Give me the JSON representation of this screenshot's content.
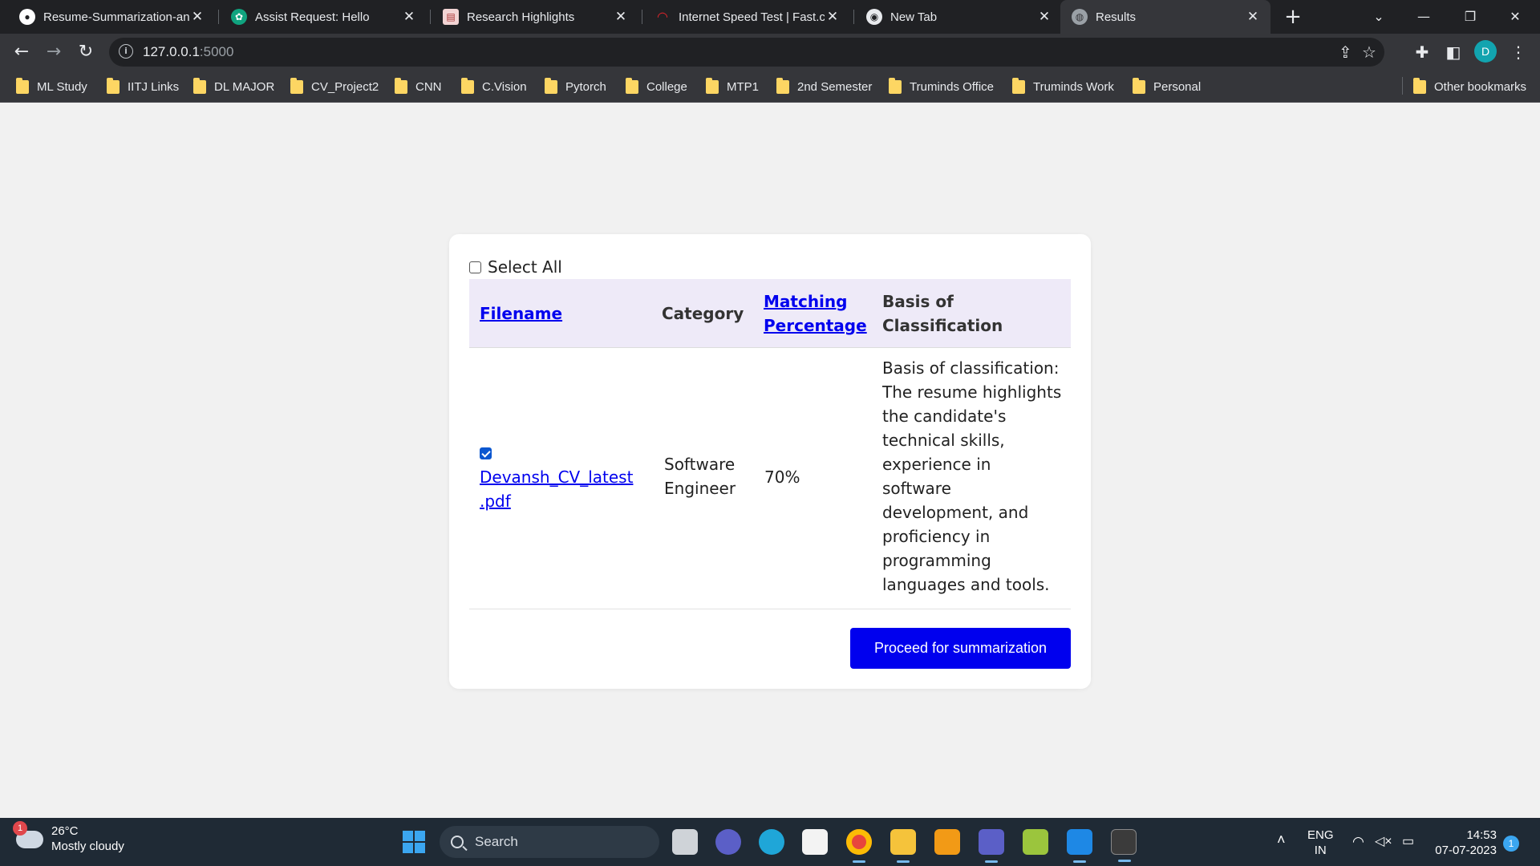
{
  "browser": {
    "tabs": [
      {
        "title": "Resume-Summarization-an",
        "icon": "github-icon"
      },
      {
        "title": "Assist Request: Hello",
        "icon": "chatgpt-icon"
      },
      {
        "title": "Research Highlights",
        "icon": "document-icon"
      },
      {
        "title": "Internet Speed Test | Fast.co",
        "icon": "speedometer-icon"
      },
      {
        "title": "New Tab",
        "icon": "chrome-icon"
      },
      {
        "title": "Results",
        "icon": "globe-icon",
        "active": true
      }
    ],
    "url_host": "127.0.0.1",
    "url_port": ":5000",
    "profile_initial": "D",
    "bookmarks": [
      "ML Study",
      "IITJ Links",
      "DL MAJOR",
      "CV_Project2",
      "CNN",
      "C.Vision",
      "Pytorch",
      "College",
      "MTP1",
      "2nd Semester",
      "Truminds Office",
      "Truminds Work",
      "Personal"
    ],
    "other_bookmarks": "Other bookmarks"
  },
  "page": {
    "select_all_label": "Select All",
    "select_all_checked": false,
    "columns": {
      "filename": "Filename",
      "category": "Category",
      "matching_line1": "Matching",
      "matching_line2": "Percentage",
      "basis": "Basis of Classification"
    },
    "rows": [
      {
        "checked": true,
        "filename_line1": "Devansh_CV_latest",
        "filename_line2": ".pdf",
        "category_line1": "Software",
        "category_line2": "Engineer",
        "matching": "70%",
        "basis_lines": [
          "Basis of classification:",
          "The resume highlights",
          "the candidate's",
          "technical skills,",
          "experience in",
          "software",
          "development, and",
          "proficiency in",
          "programming",
          "languages and tools."
        ]
      }
    ],
    "proceed_button": "Proceed for summarization",
    "link_color": "#0000ee",
    "header_bg": "#eeeaf8"
  },
  "taskbar": {
    "weather_badge": "1",
    "temperature": "26°C",
    "condition": "Mostly cloudy",
    "search_placeholder": "Search",
    "lang_line1": "ENG",
    "lang_line2": "IN",
    "time": "14:53",
    "date": "07-07-2023",
    "notification_count": "1"
  }
}
